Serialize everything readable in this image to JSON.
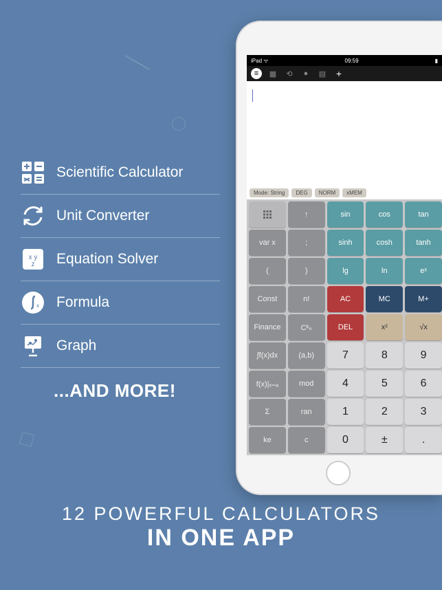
{
  "features": [
    {
      "icon": "calc-icon",
      "label": "Scientific Calculator"
    },
    {
      "icon": "refresh-icon",
      "label": "Unit Converter"
    },
    {
      "icon": "equation-icon",
      "label": "Equation Solver"
    },
    {
      "icon": "integral-icon",
      "label": "Formula"
    },
    {
      "icon": "chart-icon",
      "label": "Graph"
    }
  ],
  "and_more": "...AND MORE!",
  "tagline": {
    "line1": "12 POWERFUL CALCULATORS",
    "line2": "IN ONE APP"
  },
  "status_bar": {
    "left": "iPad ᯤ",
    "center": "09:59",
    "right": "▮"
  },
  "mode_row": [
    "Mode: String",
    "DEG",
    "NORM",
    "xMEM"
  ],
  "keypad": [
    [
      {
        "t": "",
        "c": "grid-ico",
        "i": "grid"
      },
      {
        "t": "↑",
        "c": "gray"
      },
      {
        "t": "sin",
        "c": "teal"
      },
      {
        "t": "cos",
        "c": "teal"
      },
      {
        "t": "tan",
        "c": "teal"
      }
    ],
    [
      {
        "t": "var x",
        "c": "gray"
      },
      {
        "t": ";",
        "c": "gray"
      },
      {
        "t": "sinh",
        "c": "teal"
      },
      {
        "t": "cosh",
        "c": "teal"
      },
      {
        "t": "tanh",
        "c": "teal"
      }
    ],
    [
      {
        "t": "(",
        "c": "gray"
      },
      {
        "t": ")",
        "c": "gray"
      },
      {
        "t": "lg",
        "c": "teal"
      },
      {
        "t": "ln",
        "c": "teal"
      },
      {
        "t": "eˣ",
        "c": "teal"
      }
    ],
    [
      {
        "t": "Const",
        "c": "gray"
      },
      {
        "t": "n!",
        "c": "gray"
      },
      {
        "t": "AC",
        "c": "red"
      },
      {
        "t": "MC",
        "c": "navy"
      },
      {
        "t": "M+",
        "c": "navy"
      }
    ],
    [
      {
        "t": "Finance",
        "c": "gray"
      },
      {
        "t": "Cᵏₙ",
        "c": "gray"
      },
      {
        "t": "DEL",
        "c": "red"
      },
      {
        "t": "x²",
        "c": "tan"
      },
      {
        "t": "√x",
        "c": "tan"
      }
    ],
    [
      {
        "t": "∫f(x)dx",
        "c": "gray"
      },
      {
        "t": "(a,b)",
        "c": "gray"
      },
      {
        "t": "7",
        "c": "light"
      },
      {
        "t": "8",
        "c": "light"
      },
      {
        "t": "9",
        "c": "light"
      }
    ],
    [
      {
        "t": "f(x)|ₓ₌ₐ",
        "c": "gray"
      },
      {
        "t": "mod",
        "c": "gray"
      },
      {
        "t": "4",
        "c": "light"
      },
      {
        "t": "5",
        "c": "light"
      },
      {
        "t": "6",
        "c": "light"
      }
    ],
    [
      {
        "t": "Σ",
        "c": "gray"
      },
      {
        "t": "ran",
        "c": "gray"
      },
      {
        "t": "1",
        "c": "light"
      },
      {
        "t": "2",
        "c": "light"
      },
      {
        "t": "3",
        "c": "light"
      }
    ],
    [
      {
        "t": "ke",
        "c": "gray"
      },
      {
        "t": "c",
        "c": "gray"
      },
      {
        "t": "0",
        "c": "light"
      },
      {
        "t": "±",
        "c": "light"
      },
      {
        "t": ".",
        "c": "light"
      }
    ]
  ]
}
